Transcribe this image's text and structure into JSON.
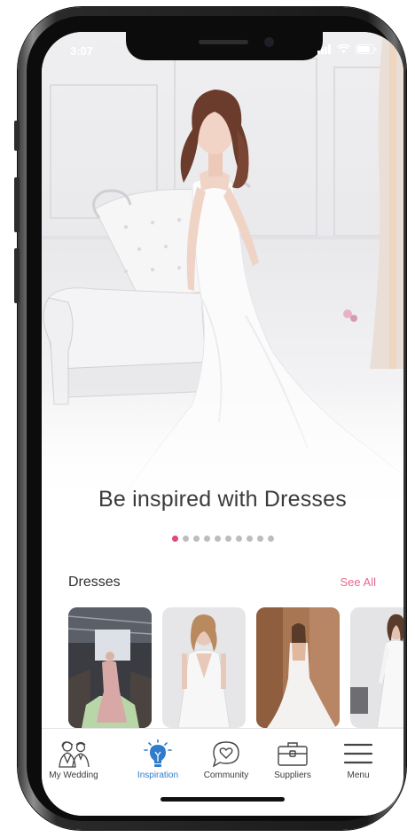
{
  "status": {
    "time": "3:07"
  },
  "hero": {
    "headline": "Be inspired with Dresses"
  },
  "carousel": {
    "total": 10,
    "active_index": 0
  },
  "section": {
    "title": "Dresses",
    "see_all": "See All"
  },
  "cards": [
    {
      "name": "runway-dress"
    },
    {
      "name": "lace-v-neck-dress"
    },
    {
      "name": "backless-mermaid-dress"
    },
    {
      "name": "long-sleeve-lace-dress"
    }
  ],
  "tabbar": {
    "items": [
      {
        "id": "my-wedding",
        "label": "My Wedding",
        "icon": "couple-icon",
        "active": false
      },
      {
        "id": "inspiration",
        "label": "Inspiration",
        "icon": "lightbulb-icon",
        "active": true
      },
      {
        "id": "community",
        "label": "Community",
        "icon": "heart-chat-icon",
        "active": false
      },
      {
        "id": "suppliers",
        "label": "Suppliers",
        "icon": "briefcase-icon",
        "active": false
      },
      {
        "id": "menu",
        "label": "Menu",
        "icon": "hamburger-icon",
        "active": false
      }
    ]
  },
  "colors": {
    "accent_pink": "#e04a73",
    "active_blue": "#2f7bcc",
    "dot_inactive": "#bdbdbd"
  }
}
